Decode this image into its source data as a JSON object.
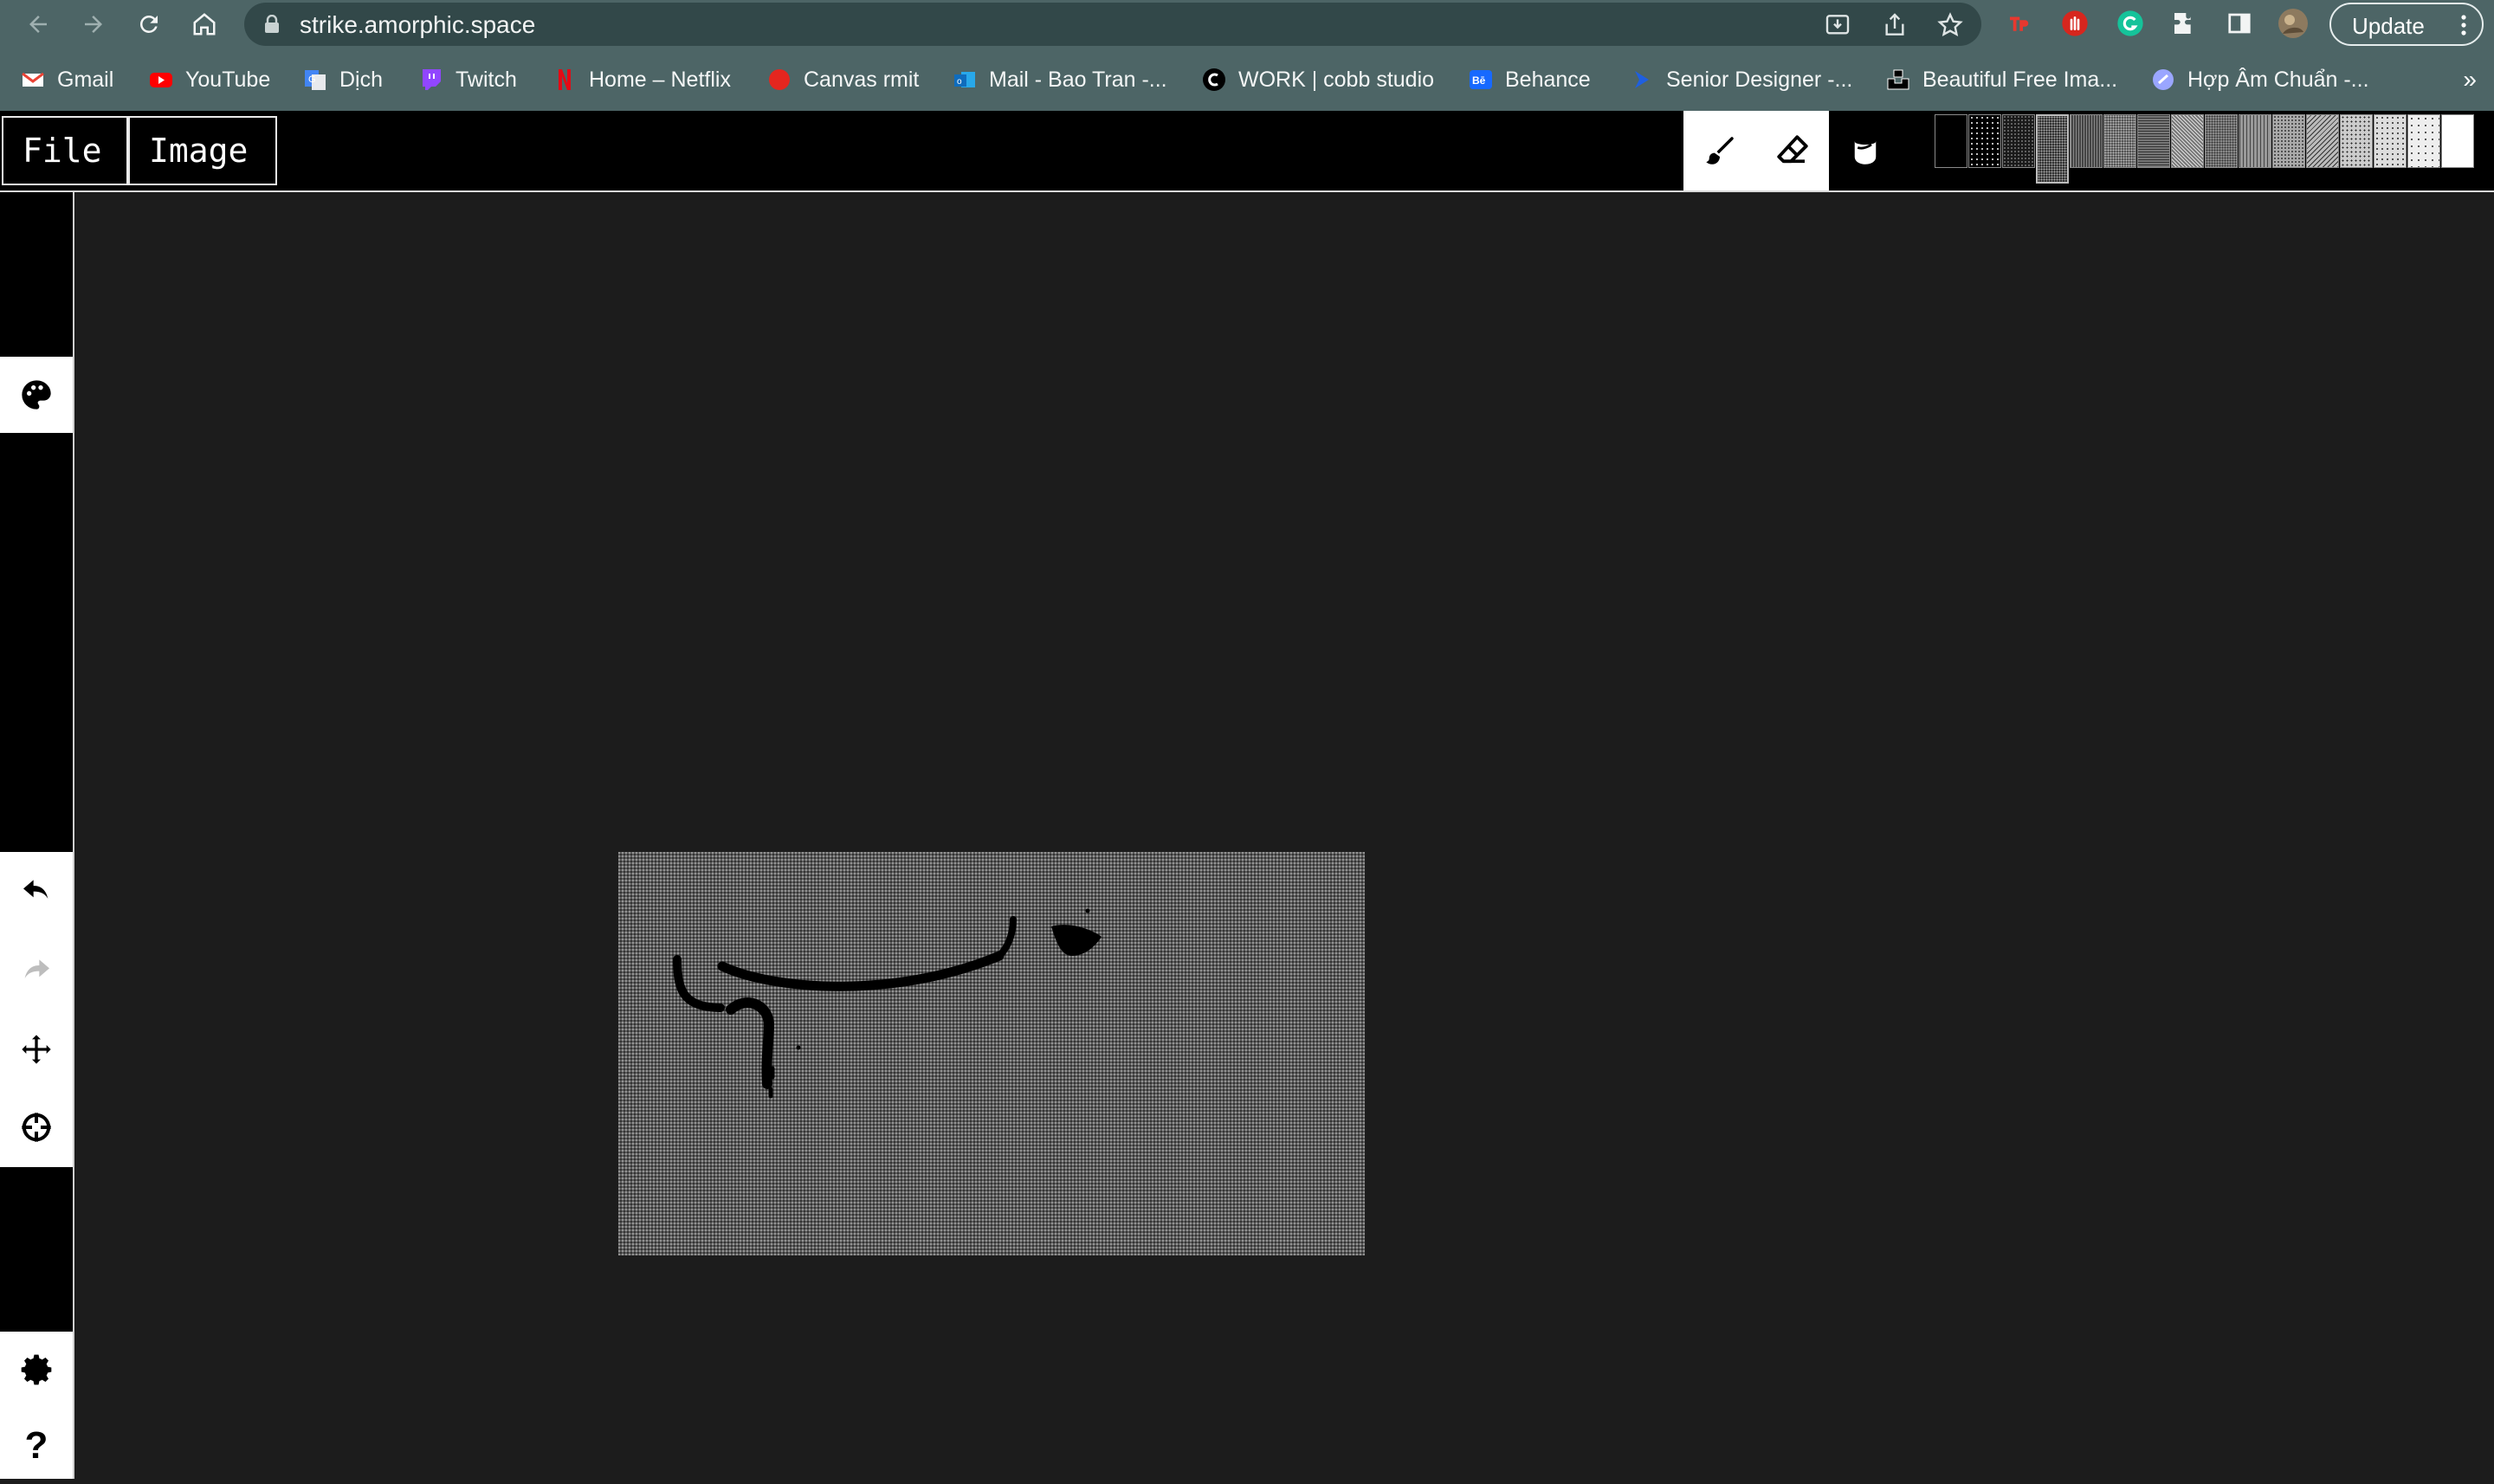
{
  "browser": {
    "url": "strike.amorphic.space",
    "update_label": "Update",
    "bookmarks": [
      {
        "label": "Gmail",
        "icon": "gmail-icon",
        "color": "#ea4335"
      },
      {
        "label": "YouTube",
        "icon": "youtube-icon",
        "color": "#ff0000"
      },
      {
        "label": "Dịch",
        "icon": "google-translate-icon",
        "color": "#4285f4"
      },
      {
        "label": "Twitch",
        "icon": "twitch-icon",
        "color": "#9146ff"
      },
      {
        "label": "Home – Netflix",
        "icon": "netflix-icon",
        "color": "#e50914"
      },
      {
        "label": "Canvas rmit",
        "icon": "canvas-icon",
        "color": "#e4261f"
      },
      {
        "label": "Mail - Bao Tran -...",
        "icon": "outlook-icon",
        "color": "#0f6cbd"
      },
      {
        "label": "WORK | cobb studio",
        "icon": "cobb-studio-icon",
        "color": "#000000"
      },
      {
        "label": "Behance",
        "icon": "behance-icon",
        "color": "#1769ff"
      },
      {
        "label": "Senior Designer -...",
        "icon": "arrow-bookmark-icon",
        "color": "#1f5fe0"
      },
      {
        "label": "Beautiful Free Ima...",
        "icon": "unsplash-icon",
        "color": "#000000"
      },
      {
        "label": "Hợp Âm Chuẩn -...",
        "icon": "hopamchuan-icon",
        "color": "#9aa6ff"
      }
    ],
    "bookmarks_overflow": "»"
  },
  "app": {
    "menus": {
      "file": "File",
      "image": "Image"
    },
    "tools": [
      {
        "name": "brush-tool",
        "icon": "paintbrush-icon",
        "active": false
      },
      {
        "name": "eraser-tool",
        "icon": "eraser-icon",
        "active": false
      },
      {
        "name": "fill-tool",
        "icon": "paint-bucket-icon",
        "active": true
      }
    ],
    "patterns": {
      "count": 16,
      "selected_index": 3
    },
    "sidebar": [
      {
        "name": "palette-button",
        "icon": "palette-icon"
      },
      {
        "name": "undo-button",
        "icon": "undo-icon"
      },
      {
        "name": "redo-button",
        "icon": "redo-icon",
        "disabled": true
      },
      {
        "name": "move-button",
        "icon": "move-arrows-icon"
      },
      {
        "name": "recenter-button",
        "icon": "crosshair-icon"
      },
      {
        "name": "settings-button",
        "icon": "gear-icon"
      },
      {
        "name": "help-button",
        "icon": "question-icon",
        "label": "?"
      }
    ]
  },
  "colors": {
    "chrome": "#4d6566",
    "omnibox": "#324849",
    "workspace": "#1c1c1c",
    "app_bar": "#000000"
  }
}
